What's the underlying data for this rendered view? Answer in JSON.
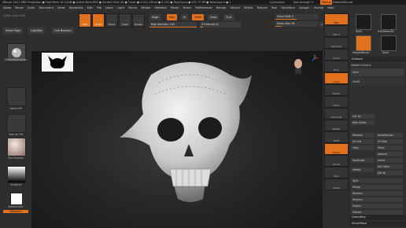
{
  "titlebar": {
    "text": "ZBrush 2021   ZBD Projection   ● Free Mem 10.14GB ● Active Mem 859 ● Scratch Disk 49 ● Timer ● 0.001 ATime ● 0.232 ● PolyCount ● 431.77 KP ● MeshCount ● 1",
    "quicksave": "QuickSave",
    "seethrough": "See-through 0",
    "menus": "Menus",
    "script": "DefaultZScript"
  },
  "menubar": {
    "items": [
      "Alpha",
      "Brush",
      "Color",
      "Document",
      "Draw",
      "Dynamics",
      "Edit",
      "File",
      "Layer",
      "Light",
      "Macro",
      "Marker",
      "Material",
      "Movie",
      "Picker",
      "Preferences",
      "Render",
      "Stencil",
      "Stroke",
      "Texture",
      "Tool",
      "Transform",
      "Zplugin",
      "Zscript",
      "Help"
    ]
  },
  "toolrow": {
    "home": "Home Page",
    "lightbox": "LightBox",
    "livebool": "Live Boolean",
    "edit": "Edit",
    "draw": "Draw",
    "move": "Move",
    "scale": "Scale",
    "rotate": "Rotate",
    "mrgb": "Mrgb",
    "rgb": "Rgb",
    "m": "M",
    "zadd": "Zadd",
    "zsub": "Zsub",
    "zcut": "Zcut",
    "rgb_intensity_label": "Rgb Intensity",
    "rgb_intensity_value": "100",
    "z_intensity_label": "Z Intensity",
    "z_intensity_value": "8",
    "focal_shift_label": "Focal Shift",
    "focal_shift_value": "0",
    "draw_size_label": "Draw Size",
    "draw_size_value": "16",
    "dynamic": "Dynamic",
    "coords": "2,456,-0.00,-0.63"
  },
  "leftshelf": {
    "brush_label": "ZRemesherGuide",
    "alpha_label": "Alpha Off",
    "texture_label": "Texture Off",
    "material_label": "SkinShade4",
    "gradient_label": "Gradient",
    "switch_label": "SwitchColor",
    "alternate_label": "Alternate"
  },
  "rightdock": {
    "buttons": [
      "BPR",
      "SPix 3",
      "Dynamic",
      "Persp",
      "Floor",
      "L.Sym",
      "Frame",
      "Move",
      "Zoom3D",
      "Rotate",
      "PolyF",
      "Transp",
      "Ghost",
      "Solo",
      "Xpose"
    ]
  },
  "tools": {
    "toolnames": [
      "Skull",
      "PolyMesh3D",
      "SimpleBrush",
      "Skull"
    ],
    "subtool": "Subtool",
    "visible_count": "Visible Count 4",
    "sub_items": [
      "Skull",
      "Skull1"
    ],
    "list_all": "List All",
    "new_folder": "New Folder",
    "rename": "Rename",
    "autoreorder": "AutoReorder",
    "all_low": "All Low",
    "all_high": "All High",
    "copy": "Copy",
    "paste": "Paste",
    "append": "Append",
    "duplicate": "Duplicate",
    "insert": "Insert",
    "delete": "Delete",
    "del_other": "Del Other",
    "del_all": "Del All",
    "split": "Split",
    "merge": "Merge",
    "boolean": "Boolean",
    "remesh": "Remesh",
    "project": "Project",
    "extract": "Extract",
    "geometry": "Geometry",
    "arraymesh": "ArrayMesh"
  },
  "colors": {
    "accent": "#e2711d",
    "bg": "#2b2b2b"
  }
}
